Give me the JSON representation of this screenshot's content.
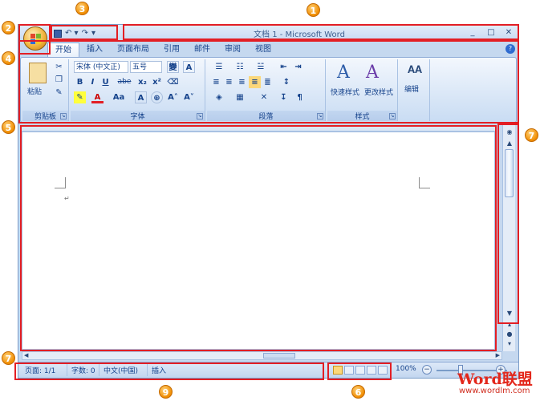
{
  "window": {
    "title": "文档 1 - Microsoft Word"
  },
  "window_controls": {
    "minimize": "_",
    "maximize": "□",
    "close": "✕"
  },
  "quick_access": {
    "undo": "↶ ▾",
    "redo": "↷",
    "more": "▾"
  },
  "tabs": [
    "开始",
    "插入",
    "页面布局",
    "引用",
    "邮件",
    "审阅",
    "视图"
  ],
  "ribbon": {
    "clipboard": {
      "paste_label": "粘贴",
      "group_label": "剪贴板"
    },
    "font": {
      "font_name": "宋体 (中文正)",
      "font_size": "五号",
      "wen_label": "變",
      "a_label": "A",
      "bold": "B",
      "italic": "I",
      "underline": "U",
      "strike": "abe",
      "subscript": "x₂",
      "superscript": "x²",
      "font_color": "A",
      "grow": "Aa",
      "group_label": "字体"
    },
    "paragraph": {
      "group_label": "段落"
    },
    "styles": {
      "quick_label": "快速样式",
      "change_label": "更改样式",
      "group_label": "样式"
    },
    "editing": {
      "label": "编辑"
    }
  },
  "status": {
    "page": "页面: 1/1",
    "words": "字数: 0",
    "language": "中文(中国)",
    "mode": "插入",
    "zoom": "100%"
  },
  "callouts": [
    "1",
    "2",
    "3",
    "4",
    "5",
    "6",
    "7",
    "7",
    "9"
  ],
  "watermark": {
    "title": "Word联盟",
    "url": "www.wordlm.com"
  },
  "colors": {
    "callout_red": "#e31e24",
    "badge_orange": "#f08c00",
    "ribbon_blue": "#d5e4f6"
  }
}
